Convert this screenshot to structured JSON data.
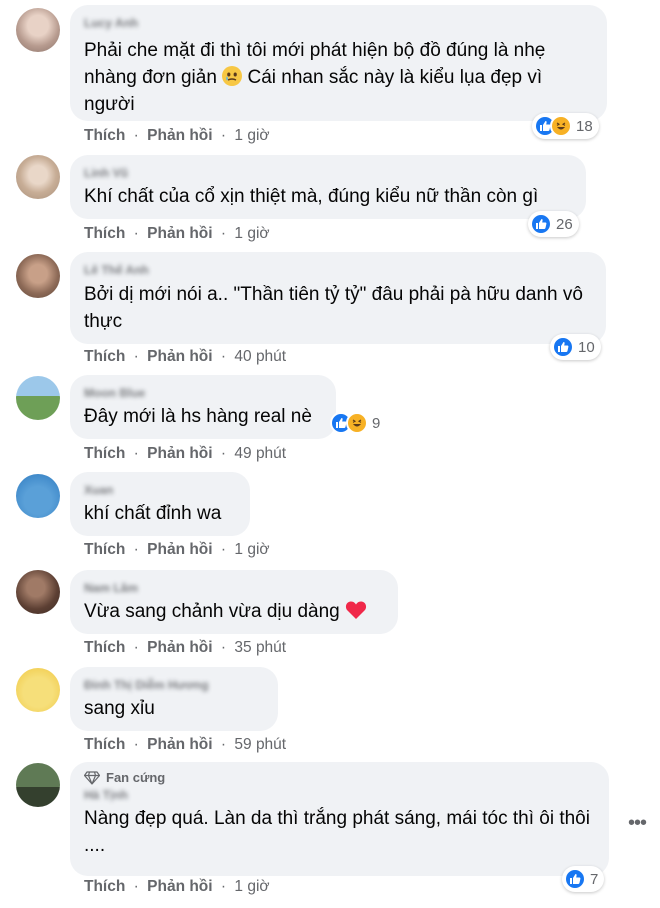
{
  "colors": {
    "bubble_bg": "#f0f2f5",
    "meta_text": "#65676b",
    "like_blue": "#1877f2",
    "haha_yellow": "#f7b125",
    "heart_red": "#f02849"
  },
  "actions": {
    "like": "Thích",
    "reply": "Phản hồi",
    "separator": "·"
  },
  "comments": [
    {
      "name": "Lucy Anh",
      "text": "Phải che mặt đi thì tôi mới phát hiện bộ đồ đúng là nhẹ nhàng đơn giản",
      "text_after_emoji": " Cái nhan sắc này là kiểu lụa đẹp vì người",
      "inline_emoji": "face-holding-back-tears-emoji",
      "time": "1 giờ",
      "reactions": [
        "like-icon",
        "haha-icon"
      ],
      "reaction_count": "18"
    },
    {
      "name": "Linh Vũ",
      "text": "Khí chất của cổ xịn thiệt mà, đúng kiểu nữ thần còn gì",
      "time": "1 giờ",
      "reactions": [
        "like-icon"
      ],
      "reaction_count": "26"
    },
    {
      "name": "Lê Thế Anh",
      "text": "Bởi dị mới nói a.. \"Thần tiên tỷ tỷ\" đâu phải pà hữu danh vô thực",
      "time": "40 phút",
      "reactions": [
        "like-icon"
      ],
      "reaction_count": "10"
    },
    {
      "name": "Moon Blue",
      "text": "Đây mới là hs hàng real nè",
      "time": "49 phút",
      "reactions": [
        "like-icon",
        "haha-icon"
      ],
      "reaction_count": "9"
    },
    {
      "name": "Xuan",
      "text": "khí chất đỉnh wa",
      "time": "1 giờ"
    },
    {
      "name": "Nam Lâm",
      "text": "Vừa sang chảnh vừa dịu dàng",
      "inline_emoji": "red-heart-emoji",
      "time": "35 phút"
    },
    {
      "name": "Đinh Thị Diễm Hương",
      "text": "sang xỉu",
      "time": "59 phút"
    },
    {
      "badge": "Fan cứng",
      "badge_icon": "diamond-icon",
      "name": "Hà Tịnh",
      "text": "Nàng đẹp quá. Làn da thì trắng phát sáng, mái tóc thì ôi thôi ....",
      "time": "1 giờ",
      "reactions": [
        "like-icon"
      ],
      "reaction_count": "7"
    }
  ],
  "more_menu": {
    "label": "•••",
    "icon": "more-options-icon"
  }
}
